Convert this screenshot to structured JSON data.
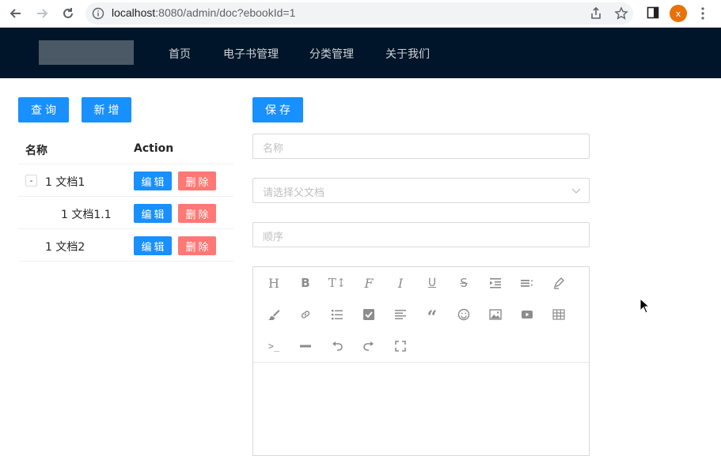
{
  "browser": {
    "url_host": "localhost",
    "url_rest": ":8080/admin/doc?ebookId=1",
    "avatar_letter": "x",
    "avatar_color": "#e8710a"
  },
  "header": {
    "menu": [
      "首页",
      "电子书管理",
      "分类管理",
      "关于我们"
    ],
    "bg_color": "#001529"
  },
  "left_toolbar": {
    "query_label": "查询",
    "add_label": "新增"
  },
  "table": {
    "columns": [
      "名称",
      "Action"
    ],
    "rows": [
      {
        "name": "1 文档1",
        "expand": "-",
        "edit": "编辑",
        "delete": "删除"
      },
      {
        "name": "1 文档1.1",
        "edit": "编辑",
        "delete": "删除"
      },
      {
        "name": "1 文档2",
        "edit": "编辑",
        "delete": "删除"
      }
    ]
  },
  "form": {
    "save_label": "保存",
    "name_placeholder": "名称",
    "parent_placeholder": "请选择父文档",
    "order_placeholder": "顺序"
  },
  "editor_toolbar": {
    "row1": [
      "heading-icon",
      "bold-icon",
      "font-size-icon",
      "font-family-icon",
      "italic-icon",
      "underline-icon",
      "strikethrough-icon",
      "indent-icon",
      "line-height-icon",
      "text-color-icon"
    ],
    "row2": [
      "background-color-icon",
      "link-icon",
      "list-icon",
      "todo-icon",
      "justify-icon",
      "quote-icon",
      "emoticon-icon",
      "image-icon",
      "video-icon",
      "table-icon"
    ],
    "row3": [
      "code-icon",
      "divider-icon",
      "undo-icon",
      "redo-icon",
      "fullscreen-icon"
    ]
  },
  "colors": {
    "primary": "#1890ff",
    "danger": "#ff7875"
  }
}
